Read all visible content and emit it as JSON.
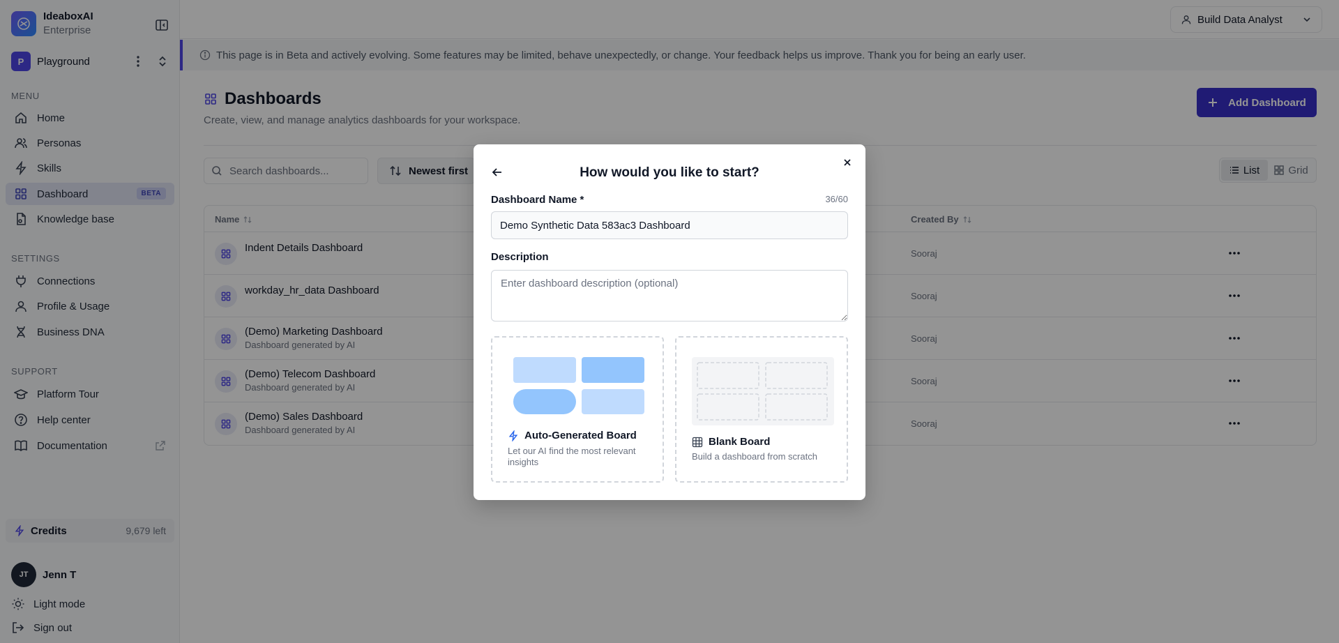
{
  "brand": {
    "name": "IdeaboxAI",
    "plan": "Enterprise"
  },
  "workspace": {
    "badge": "P",
    "name": "Playground"
  },
  "sidebar": {
    "menu_label": "MENU",
    "menu": [
      {
        "label": "Home",
        "icon": "home-icon"
      },
      {
        "label": "Personas",
        "icon": "users-icon"
      },
      {
        "label": "Skills",
        "icon": "bolt-icon"
      },
      {
        "label": "Dashboard",
        "icon": "grid-icon",
        "badge": "BETA",
        "active": true
      },
      {
        "label": "Knowledge base",
        "icon": "file-icon"
      }
    ],
    "settings_label": "SETTINGS",
    "settings": [
      {
        "label": "Connections",
        "icon": "plug-icon"
      },
      {
        "label": "Profile & Usage",
        "icon": "user-icon"
      },
      {
        "label": "Business DNA",
        "icon": "dna-icon"
      }
    ],
    "support_label": "SUPPORT",
    "support": [
      {
        "label": "Platform Tour",
        "icon": "graduation-cap-icon"
      },
      {
        "label": "Help center",
        "icon": "help-circle-icon"
      },
      {
        "label": "Documentation",
        "icon": "book-icon"
      }
    ],
    "credits": {
      "label": "Credits",
      "value": "9,679 left"
    },
    "user": {
      "initials": "JT",
      "name": "Jenn T"
    },
    "theme_label": "Light mode",
    "signout_label": "Sign out"
  },
  "topbar": {
    "persona": "Build Data Analyst"
  },
  "banner": "This page is in Beta and actively evolving. Some features may be limited, behave unexpectedly, or change. Your feedback helps us improve. Thank you for being an early user.",
  "page": {
    "title": "Dashboards",
    "subtitle": "Create, view, and manage analytics dashboards for your workspace.",
    "add_label": "Add Dashboard",
    "search_placeholder": "Search dashboards...",
    "sort_label": "Newest first",
    "view_list": "List",
    "view_grid": "Grid"
  },
  "table": {
    "col_name": "Name",
    "col_created_by": "Created By",
    "rows": [
      {
        "name": "Indent Details Dashboard",
        "desc": "",
        "created_by": "Sooraj"
      },
      {
        "name": "workday_hr_data Dashboard",
        "desc": "",
        "created_by": "Sooraj"
      },
      {
        "name": "(Demo) Marketing Dashboard",
        "desc": "Dashboard generated by AI",
        "created_by": "Sooraj"
      },
      {
        "name": "(Demo) Telecom Dashboard",
        "desc": "Dashboard generated by AI",
        "created_by": "Sooraj"
      },
      {
        "name": "(Demo) Sales Dashboard",
        "desc": "Dashboard generated by AI",
        "created_by": "Sooraj"
      }
    ]
  },
  "modal": {
    "title": "How would you like to start?",
    "name_label": "Dashboard Name *",
    "name_count": "36/60",
    "name_value": "Demo Synthetic Data 583ac3 Dashboard",
    "desc_label": "Description",
    "desc_placeholder": "Enter dashboard description (optional)",
    "auto_title": "Auto-Generated Board",
    "auto_desc": "Let our AI find the most relevant insights",
    "blank_title": "Blank Board",
    "blank_desc": "Build a dashboard from scratch"
  }
}
